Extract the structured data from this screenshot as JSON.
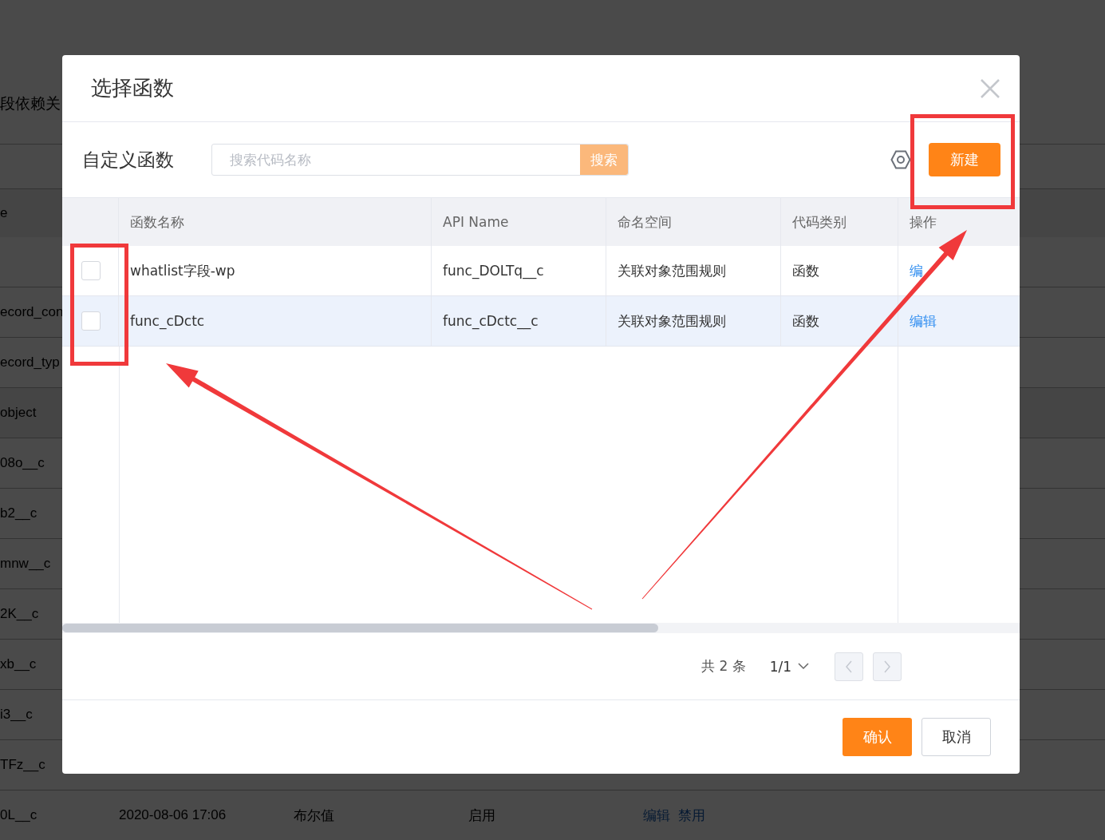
{
  "background": {
    "title": "段依赖关",
    "header_cell": "e",
    "rows": [
      {
        "cells": [
          "ecord_con"
        ]
      },
      {
        "cells": [
          "ecord_typ"
        ]
      },
      {
        "cells": [
          "object"
        ]
      },
      {
        "cells": [
          "08o__c"
        ]
      },
      {
        "cells": [
          "b2__c"
        ]
      },
      {
        "cells": [
          "mnw__c"
        ]
      },
      {
        "cells": [
          "2K__c"
        ]
      },
      {
        "cells": [
          "xb__c"
        ]
      },
      {
        "cells": [
          "i3__c"
        ]
      },
      {
        "cells": [
          "TFz__c"
        ]
      },
      {
        "cells": [
          "0L__c",
          "2020-08-06 17:06",
          "布尔值",
          "启用"
        ],
        "actions": [
          "编辑",
          "禁用"
        ]
      }
    ]
  },
  "dialog": {
    "title": "选择函数",
    "section_label": "自定义函数",
    "search": {
      "placeholder": "搜索代码名称",
      "button": "搜索"
    },
    "new_button": "新建",
    "table": {
      "columns": [
        "函数名称",
        "API Name",
        "命名空间",
        "代码类别",
        "操作"
      ],
      "rows": [
        {
          "checked": false,
          "highlighted": false,
          "name": "whatlist字段-wp",
          "api_name": "func_DOLTq__c",
          "namespace": "关联对象范围规则",
          "type": "函数",
          "action": "编"
        },
        {
          "checked": false,
          "highlighted": true,
          "name": "func_cDctc",
          "api_name": "func_cDctc__c",
          "namespace": "关联对象范围规则",
          "type": "函数",
          "action": "编辑"
        }
      ]
    },
    "pagination": {
      "total": "共 2 条",
      "page": "1/1",
      "prev_disabled": true,
      "next_disabled": true
    },
    "buttons": {
      "confirm": "确认",
      "cancel": "取消"
    }
  }
}
